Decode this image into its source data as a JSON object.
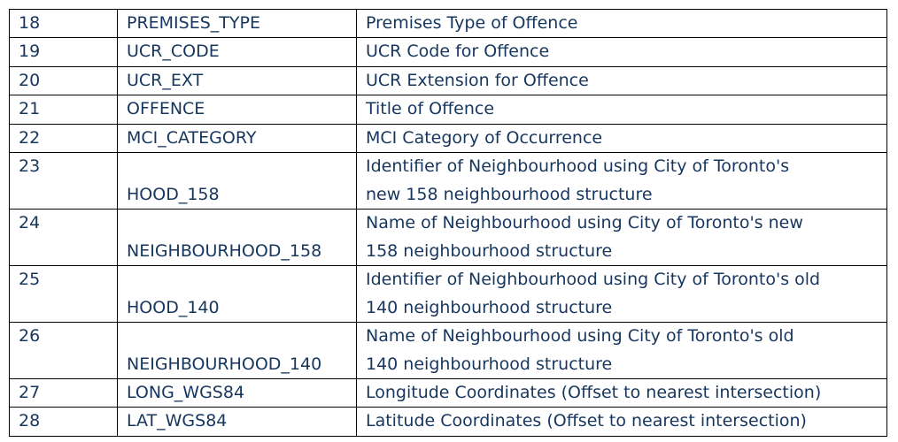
{
  "table": {
    "rows": [
      {
        "num": "18",
        "field": "PREMISES_TYPE",
        "lines": [
          "Premises Type of Offence"
        ]
      },
      {
        "num": "19",
        "field": "UCR_CODE",
        "lines": [
          "UCR Code for Offence"
        ]
      },
      {
        "num": "20",
        "field": "UCR_EXT",
        "lines": [
          "UCR Extension for Offence"
        ]
      },
      {
        "num": "21",
        "field": "OFFENCE",
        "lines": [
          "Title of Offence"
        ]
      },
      {
        "num": "22",
        "field": "MCI_CATEGORY",
        "lines": [
          "MCI Category of Occurrence"
        ]
      },
      {
        "num": "23",
        "field": "HOOD_158",
        "lines": [
          "Identifier of Neighbourhood using City of Toronto's",
          "new 158 neighbourhood structure"
        ]
      },
      {
        "num": "24",
        "field": "NEIGHBOURHOOD_158",
        "lines": [
          "Name of Neighbourhood using City of Toronto's new",
          "158 neighbourhood structure"
        ]
      },
      {
        "num": "25",
        "field": "HOOD_140",
        "lines": [
          "Identifier of Neighbourhood using City of Toronto's old",
          "140 neighbourhood structure"
        ]
      },
      {
        "num": "26",
        "field": "NEIGHBOURHOOD_140",
        "lines": [
          "Name of Neighbourhood using City of Toronto's old",
          "140 neighbourhood structure"
        ]
      },
      {
        "num": "27",
        "field": "LONG_WGS84",
        "lines": [
          "Longitude Coordinates (Offset to nearest intersection)"
        ]
      },
      {
        "num": "28",
        "field": "LAT_WGS84",
        "lines": [
          "Latitude Coordinates (Offset to nearest intersection)"
        ]
      }
    ]
  }
}
